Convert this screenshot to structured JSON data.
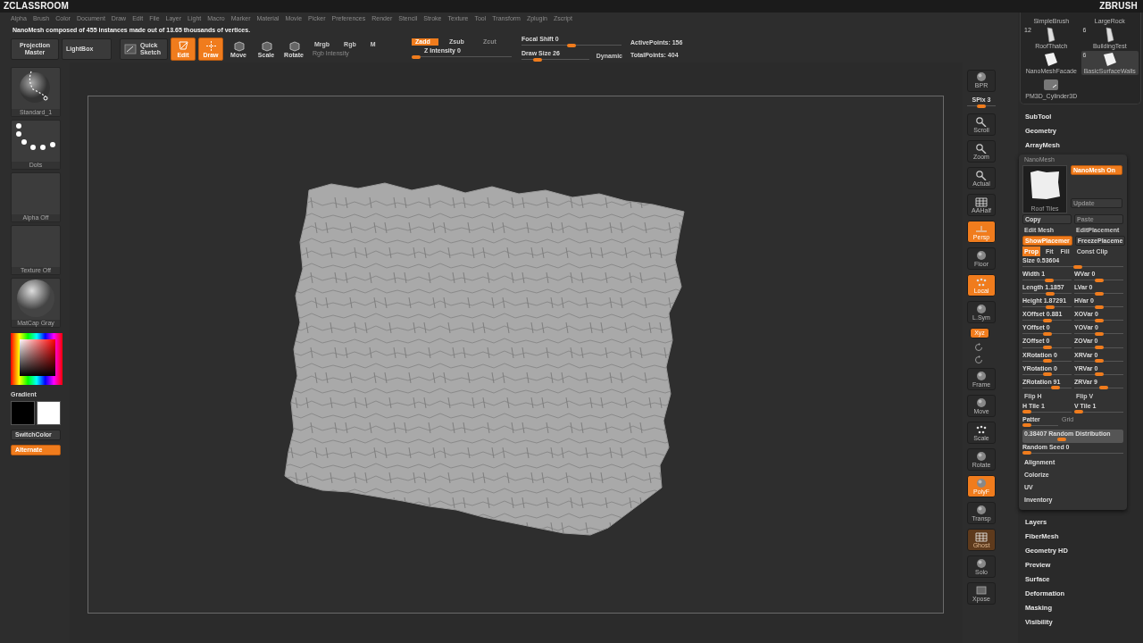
{
  "header": {
    "left_logo": "ZCLASSROOM",
    "right_logo": "ZBRUSH"
  },
  "menu": [
    "Alpha",
    "Brush",
    "Color",
    "Document",
    "Draw",
    "Edit",
    "File",
    "Layer",
    "Light",
    "Macro",
    "Marker",
    "Material",
    "Movie",
    "Picker",
    "Preferences",
    "Render",
    "Stencil",
    "Stroke",
    "Texture",
    "Tool",
    "Transform",
    "Zplugin",
    "Zscript"
  ],
  "status_message": "NanoMesh composed of 455 instances made out of 13.65 thousands of vertices.",
  "toolbar": {
    "buttons": [
      {
        "label": "Projection Master"
      },
      {
        "label": "LightBox"
      },
      {
        "label": "Quick Sketch"
      }
    ],
    "transform_modes": [
      {
        "label": "Edit",
        "on": true
      },
      {
        "label": "Draw",
        "on": true
      },
      {
        "label": "Move",
        "on": false
      },
      {
        "label": "Scale",
        "on": false
      },
      {
        "label": "Rotate",
        "on": false
      }
    ],
    "color_channels": [
      {
        "label": "Mrgb",
        "on": false
      },
      {
        "label": "Rgb",
        "on": false
      },
      {
        "label": "M",
        "on": false
      }
    ],
    "rgb_intensity": {
      "label": "Rgb Intensity",
      "disabled": true
    },
    "depth_modes": [
      {
        "label": "Zadd",
        "on": true,
        "disabled": false
      },
      {
        "label": "Zsub",
        "on": false,
        "disabled": false
      },
      {
        "label": "Zcut",
        "on": false,
        "disabled": true
      }
    ],
    "z_intensity": {
      "label": "Z Intensity 0",
      "level": 0
    },
    "focal_shift": {
      "label": "Focal Shift 0",
      "level": 0.5
    },
    "draw_size": {
      "label": "Draw Size 26",
      "level": 0.2
    },
    "dynamic": "Dynamic",
    "points": [
      "ActivePoints: 156",
      "TotalPoints: 404"
    ]
  },
  "left_shelf": {
    "thumbnails": [
      {
        "kind": "brush",
        "label": "Standard_1"
      },
      {
        "kind": "stroke",
        "label": "Dots"
      },
      {
        "kind": "alpha",
        "label": "Alpha Off"
      },
      {
        "kind": "texture",
        "label": "Texture Off"
      },
      {
        "kind": "material",
        "label": "MatCap Gray"
      }
    ],
    "gradient_label": "Gradient",
    "swatches": [
      {
        "color": "#000000"
      },
      {
        "color": "#ffffff"
      }
    ],
    "buttons": [
      {
        "label": "SwitchColor",
        "on": false
      },
      {
        "label": "Alternate",
        "on": true
      }
    ]
  },
  "tool_column": [
    {
      "kind": "button",
      "label": "BPR",
      "on": false,
      "disabled": false
    },
    {
      "kind": "slider",
      "label": "SPix 3",
      "level": 0.5
    },
    {
      "kind": "button",
      "label": "Scroll",
      "on": false,
      "disabled": false
    },
    {
      "kind": "button",
      "label": "Zoom",
      "on": false,
      "disabled": false
    },
    {
      "kind": "button",
      "label": "Actual",
      "on": false,
      "disabled": false
    },
    {
      "kind": "button",
      "label": "AAHalf",
      "on": false,
      "disabled": false
    },
    {
      "kind": "button",
      "label": "Persp",
      "on": true,
      "disabled": false
    },
    {
      "kind": "button",
      "label": "Floor",
      "on": false,
      "disabled": false
    },
    {
      "kind": "button",
      "label": "Local",
      "on": true,
      "disabled": false
    },
    {
      "kind": "button",
      "label": "L.Sym",
      "on": false,
      "disabled": false
    },
    {
      "kind": "toggle",
      "label": "Xyz",
      "on": true,
      "disabled": false
    },
    {
      "kind": "small"
    },
    {
      "kind": "small"
    },
    {
      "kind": "button",
      "label": "Frame",
      "on": false,
      "disabled": false
    },
    {
      "kind": "button",
      "label": "Move",
      "on": false,
      "disabled": false
    },
    {
      "kind": "button",
      "label": "Scale",
      "on": false,
      "disabled": false
    },
    {
      "kind": "button",
      "label": "Rotate",
      "on": false,
      "disabled": false
    },
    {
      "kind": "button",
      "label": "PolyF",
      "on": true,
      "disabled": false
    },
    {
      "kind": "button",
      "label": "Transp",
      "on": false,
      "disabled": false
    },
    {
      "kind": "button",
      "label": "Ghost",
      "on": true,
      "disabled": true
    },
    {
      "kind": "button",
      "label": "Solo",
      "on": false,
      "disabled": false
    },
    {
      "kind": "button",
      "label": "Xpose",
      "on": false,
      "disabled": false
    }
  ],
  "tool_panel": {
    "thumbnails": [
      {
        "kind": "none",
        "label": "SimpleBrush",
        "selected": false
      },
      {
        "kind": "none",
        "label": "LargeRock",
        "selected": false
      },
      {
        "kind": "blade",
        "label": "RoofThatch",
        "count": "12",
        "selected": false
      },
      {
        "kind": "blade",
        "label": "BuildingTest",
        "count": "6",
        "selected": false
      },
      {
        "kind": "plate",
        "label": "NanoMeshFacade",
        "selected": false
      },
      {
        "kind": "plate",
        "label": "BasicSurfaceWalls",
        "count": "6",
        "selected": true
      },
      {
        "kind": "cylinder",
        "label": "PM3D_Cylinder3D",
        "selected": false
      }
    ],
    "sections_top": [
      "SubTool",
      "Geometry",
      "ArrayMesh"
    ],
    "nanomesh": {
      "title": "NanoMesh",
      "preview_label": "Roof Tiles",
      "side_buttons": [
        {
          "label": "NanoMesh On",
          "on": true,
          "disabled": false
        },
        {
          "label": "Update",
          "on": false,
          "disabled": true
        }
      ],
      "button_rows": [
        [
          {
            "label": "Copy",
            "on": false,
            "disabled": false
          },
          {
            "label": "Paste",
            "on": false,
            "disabled": true
          }
        ],
        [
          {
            "label": "Edit Mesh",
            "on": false,
            "disabled": false
          },
          {
            "label": "EditPlacement",
            "on": false,
            "disabled": false
          }
        ],
        [
          {
            "label": "ShowPlacemer",
            "on": true,
            "disabled": false
          },
          {
            "label": "FreezePlaceme",
            "on": false,
            "disabled": false
          }
        ]
      ],
      "options": [
        {
          "label": "Prop",
          "on": true
        },
        {
          "label": "Fit",
          "on": false
        },
        {
          "label": "Fill",
          "on": false
        },
        {
          "label": "Const Clip",
          "on": false
        }
      ],
      "size": {
        "label": "Size 0.53604",
        "level": 0.55
      },
      "slider_pairs": [
        [
          {
            "label": "Width 1",
            "level": 0.55
          },
          {
            "label": "WVar 0",
            "level": 0.5
          }
        ],
        [
          {
            "label": "Length 1.1857",
            "level": 0.57
          },
          {
            "label": "LVar 0",
            "level": 0.5
          }
        ],
        [
          {
            "label": "Height 1.87291",
            "level": 0.57
          },
          {
            "label": "HVar 0",
            "level": 0.5
          }
        ],
        [
          {
            "label": "XOffset 0.881",
            "level": 0.5
          },
          {
            "label": "XOVar 0",
            "level": 0.5
          }
        ],
        [
          {
            "label": "YOffset 0",
            "level": 0.5
          },
          {
            "label": "YOVar 0",
            "level": 0.5
          }
        ],
        [
          {
            "label": "ZOffset 0",
            "level": 0.5
          },
          {
            "label": "ZOVar 0",
            "level": 0.5
          }
        ],
        [
          {
            "label": "XRotation 0",
            "level": 0.5
          },
          {
            "label": "XRVar 0",
            "level": 0.5
          }
        ],
        [
          {
            "label": "YRotation 0",
            "level": 0.5
          },
          {
            "label": "YRVar 0",
            "level": 0.5
          }
        ],
        [
          {
            "label": "ZRotation 91",
            "level": 0.72
          },
          {
            "label": "ZRVar 9",
            "level": 0.62
          }
        ]
      ],
      "flips": [
        "Flip H",
        "Flip V"
      ],
      "tiles": [
        {
          "label": "H Tile 1",
          "level": 0
        },
        {
          "label": "V Tile 1",
          "level": 0
        }
      ],
      "pattern": {
        "label": "Patter",
        "value": "Grid",
        "level": 0
      },
      "random_distribution": {
        "label": "0.38407 Random Distribution",
        "level": 0.38
      },
      "random_seed": {
        "label": "Random Seed 0",
        "level": 0
      },
      "subsections": [
        "Alignment",
        "Colorize",
        "UV",
        "Inventory"
      ]
    },
    "sections_bottom": [
      "Layers",
      "FiberMesh",
      "Geometry HD",
      "Preview",
      "Surface",
      "Deformation",
      "Masking",
      "Visibility"
    ]
  }
}
